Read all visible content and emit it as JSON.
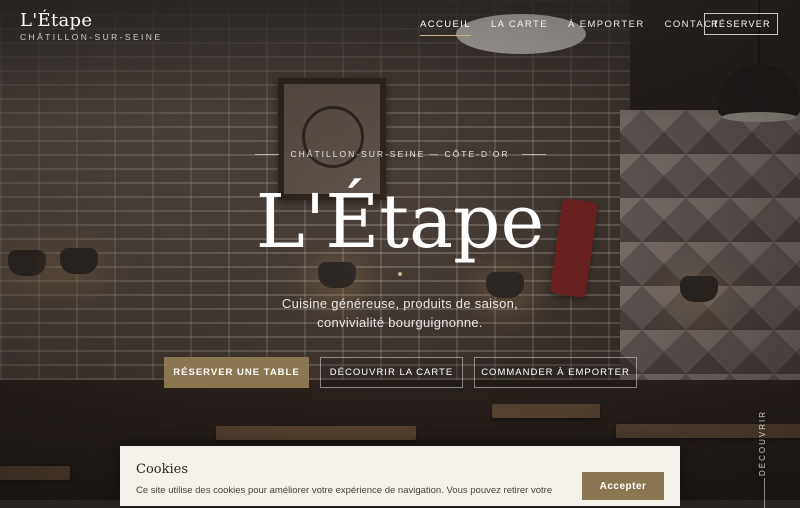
{
  "brand": {
    "name": "L'Étape",
    "location": "CHÂTILLON-SUR-SEINE"
  },
  "nav": {
    "items": [
      {
        "label": "ACCUEIL",
        "active": true
      },
      {
        "label": "LA CARTE",
        "active": false
      },
      {
        "label": "À EMPORTER",
        "active": false
      },
      {
        "label": "CONTACT",
        "active": false
      }
    ],
    "reserve_label": "RÉSERVER"
  },
  "hero": {
    "eyebrow": "CHÂTILLON-SUR-SEINE — CÔTE-D'OR",
    "title": "L'Étape",
    "tagline_line1": "Cuisine généreuse, produits de saison,",
    "tagline_line2": "convivialité bourguignonne.",
    "cta_reserve": "RÉSERVER UNE TABLE",
    "cta_carte": "DÉCOUVRIR LA CARTE",
    "cta_emporter": "COMMANDER À EMPORTER"
  },
  "scroll": {
    "label": "DÉCOUVRIR"
  },
  "cookie": {
    "title": "Cookies",
    "text": "Ce site utilise des cookies pour améliorer votre expérience de navigation. Vous pouvez retirer votre",
    "accept_label": "Accepter"
  },
  "colors": {
    "accent": "#8a7650",
    "active_underline": "#c9b48a",
    "cookie_bg": "#f5f2ec"
  }
}
